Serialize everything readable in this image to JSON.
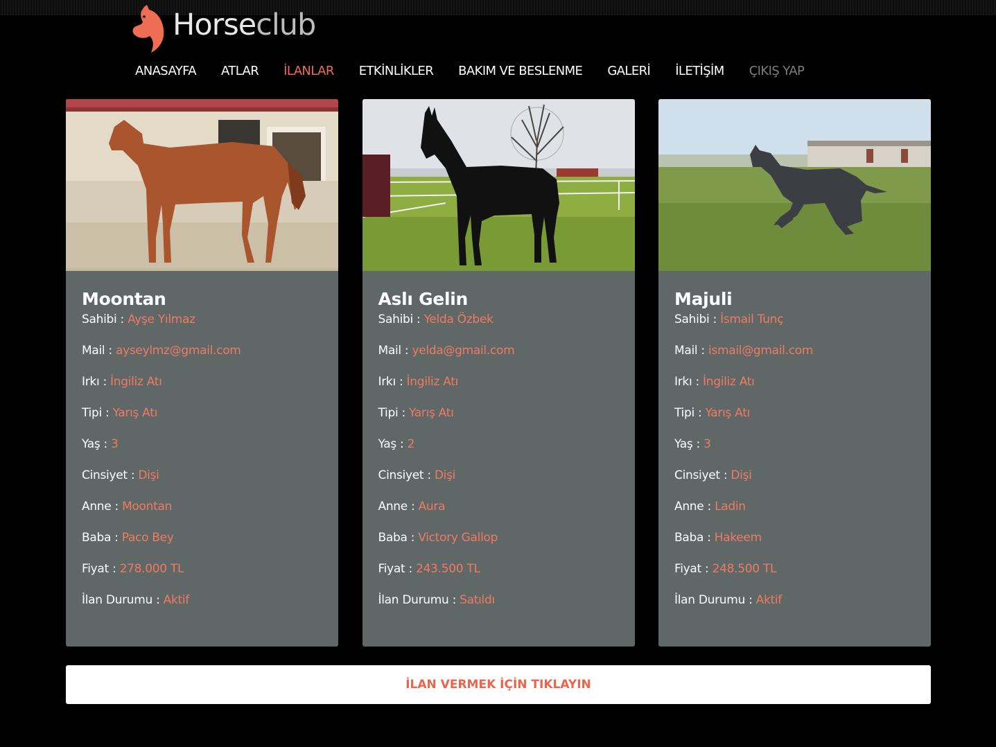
{
  "brand": {
    "name_part1": "Horse",
    "name_part2": "club",
    "accent_color": "#ee6e55"
  },
  "nav": {
    "items": [
      {
        "label": "ANASAYFA"
      },
      {
        "label": "ATLAR"
      },
      {
        "label": "İLANLAR",
        "active": true
      },
      {
        "label": "ETKİNLİKLER"
      },
      {
        "label": "BAKIM VE BESLENME"
      },
      {
        "label": "GALERİ"
      },
      {
        "label": "İLETİŞİM"
      },
      {
        "label": "ÇIKIŞ YAP",
        "muted": true
      }
    ]
  },
  "labels": {
    "owner": "Sahibi :",
    "mail": "Mail :",
    "breed": "Irkı :",
    "type": "Tipi :",
    "age": "Yaş :",
    "gender": "Cinsiyet :",
    "mother": "Anne :",
    "father": "Baba :",
    "price": "Fiyat :",
    "status": "İlan Durumu :"
  },
  "listings": [
    {
      "name": "Moontan",
      "photo": "chestnut-horse-photo",
      "owner": "Ayşe Yılmaz",
      "mail": "ayseylmz@gmail.com",
      "breed": "İngiliz Atı",
      "type": "Yarış Atı",
      "age": "3",
      "gender": "Dişi",
      "mother": "Moontan",
      "father": "Paco Bey",
      "price": "278.000 TL",
      "status": "Aktif"
    },
    {
      "name": "Aslı Gelin",
      "photo": "black-horse-photo",
      "owner": "Yelda Özbek",
      "mail": "yelda@gmail.com",
      "breed": "İngiliz Atı",
      "type": "Yarış Atı",
      "age": "2",
      "gender": "Dişi",
      "mother": "Aura",
      "father": "Victory Gallop",
      "price": "243.500 TL",
      "status": "Satıldı"
    },
    {
      "name": "Majuli",
      "photo": "grey-horse-photo",
      "owner": "İsmail Tunç",
      "mail": "ismail@gmail.com",
      "breed": "İngiliz Atı",
      "type": "Yarış Atı",
      "age": "3",
      "gender": "Dişi",
      "mother": "Ladin",
      "father": "Hakeem",
      "price": "248.500 TL",
      "status": "Aktif"
    }
  ],
  "cta": {
    "label": "İLAN VERMEK İÇİN TIKLAYIN"
  }
}
